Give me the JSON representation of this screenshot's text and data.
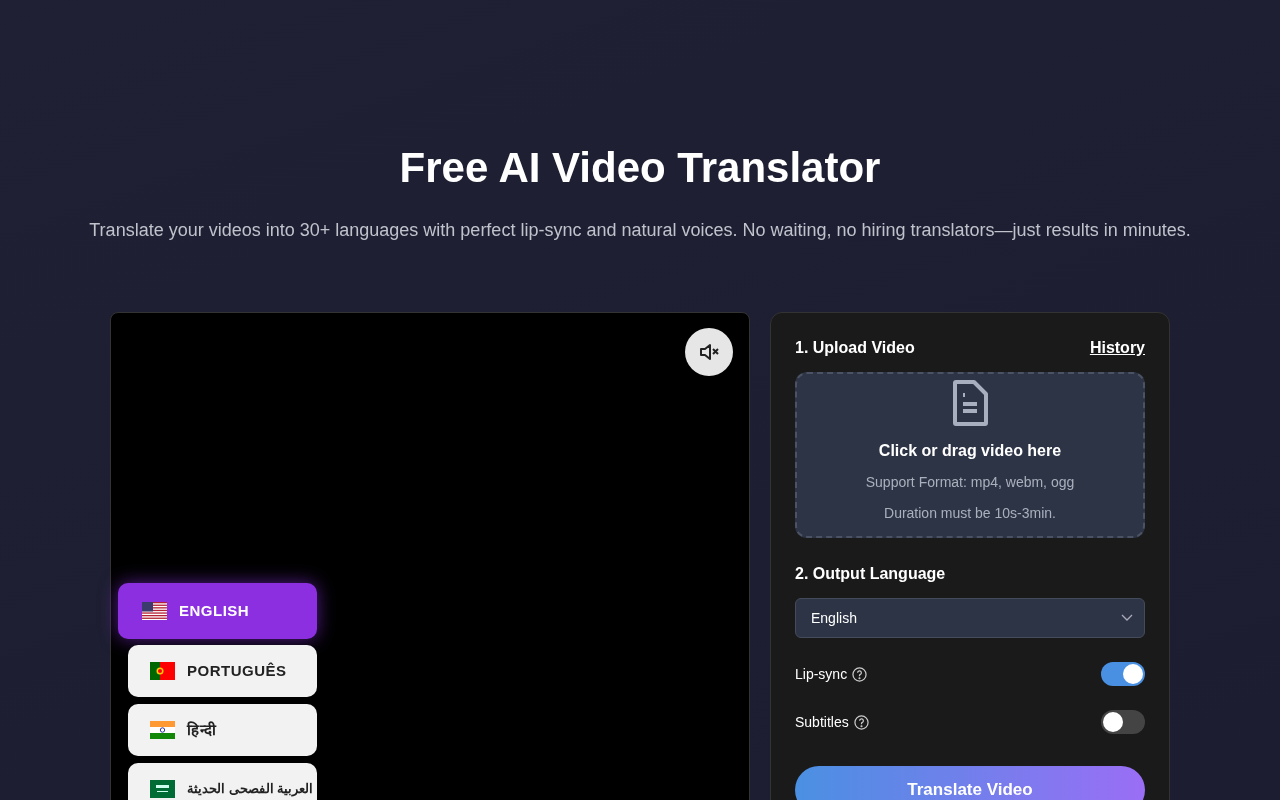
{
  "hero": {
    "title": "Free AI Video Translator",
    "subtitle": "Translate your videos into 30+ languages with perfect lip-sync and natural voices. No waiting, no hiring translators—just results in minutes."
  },
  "player": {
    "muted": true,
    "languages": [
      {
        "label": "ENGLISH",
        "kind": "us",
        "selected": true
      },
      {
        "label": "PORTUGUÊS",
        "kind": "pt",
        "selected": false
      },
      {
        "label": "हिन्दी",
        "kind": "in",
        "selected": false
      },
      {
        "label": "العربية الفصحى الحديثة",
        "kind": "sa",
        "selected": false
      }
    ]
  },
  "upload": {
    "heading": "1. Upload Video",
    "history_link": "History",
    "drop_title": "Click or drag video here",
    "drop_lines": [
      "Support Format: mp4, webm, ogg",
      "Duration must be 10s-3min."
    ]
  },
  "output": {
    "heading": "2. Output Language",
    "language": "English",
    "toggles": [
      {
        "label": "Lip-sync",
        "on": true
      },
      {
        "label": "Subtitles",
        "on": false
      }
    ],
    "submit": "Translate Video"
  }
}
